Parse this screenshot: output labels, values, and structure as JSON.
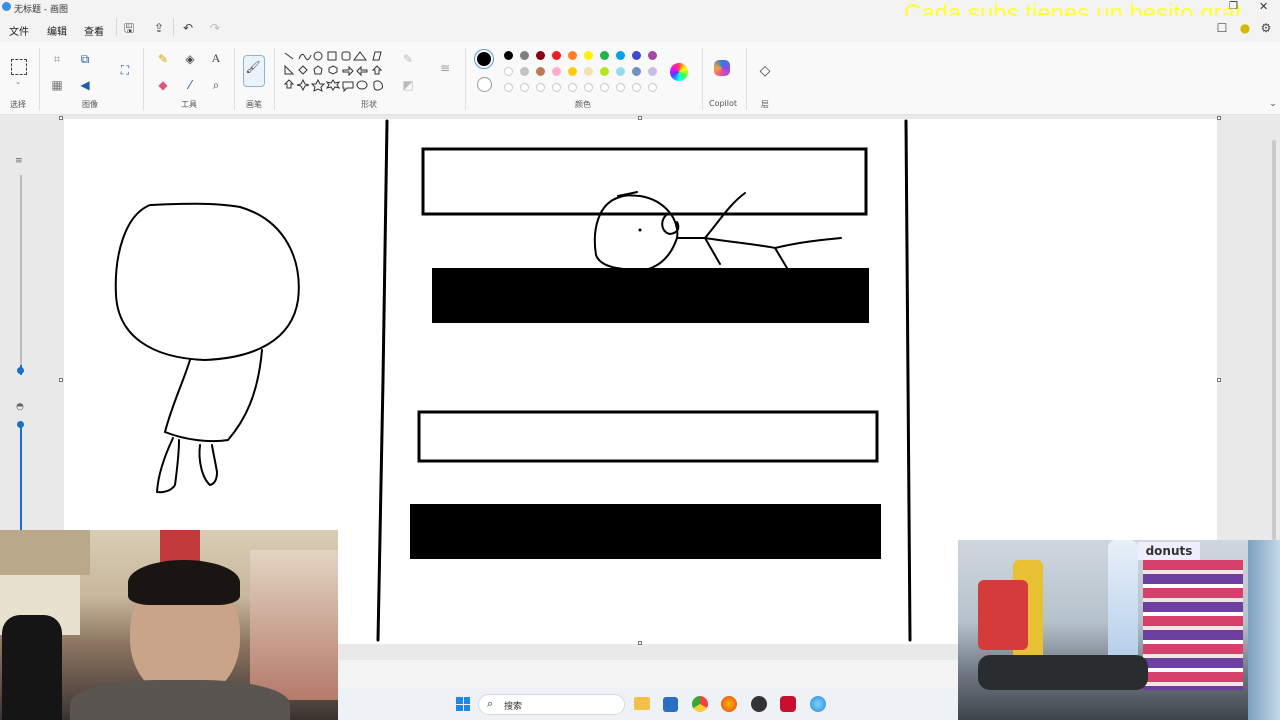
{
  "window": {
    "title": "无标题 - 画图"
  },
  "overlay_text": "Cada subs tienes un besito grat",
  "menu": {
    "file": "文件",
    "edit": "编辑",
    "view": "查看"
  },
  "ribbon": {
    "groups": {
      "select": "选择",
      "image": "图像",
      "tools": "工具",
      "brushes": "画笔",
      "shapes": "形状",
      "colors": "颜色",
      "copilot": "Copilot",
      "layers": "层"
    },
    "text_tool": "A",
    "colors_row1": [
      "#000000",
      "#7f7f7f",
      "#880015",
      "#ed1c24",
      "#ff7f27",
      "#fff200",
      "#22b14c",
      "#00a2e8",
      "#3f48cc",
      "#a349a4"
    ],
    "colors_row2": [
      "#ffffff",
      "#c3c3c3",
      "#b97a57",
      "#ffaec9",
      "#ffc90e",
      "#efe4b0",
      "#b5e61d",
      "#99d9ea",
      "#7092be",
      "#c8bfe7"
    ],
    "primary_color": "#000000",
    "secondary_color": "#ffffff"
  },
  "taskbar": {
    "search_label": "搜索"
  },
  "webcam_right": {
    "sign": "donuts"
  }
}
